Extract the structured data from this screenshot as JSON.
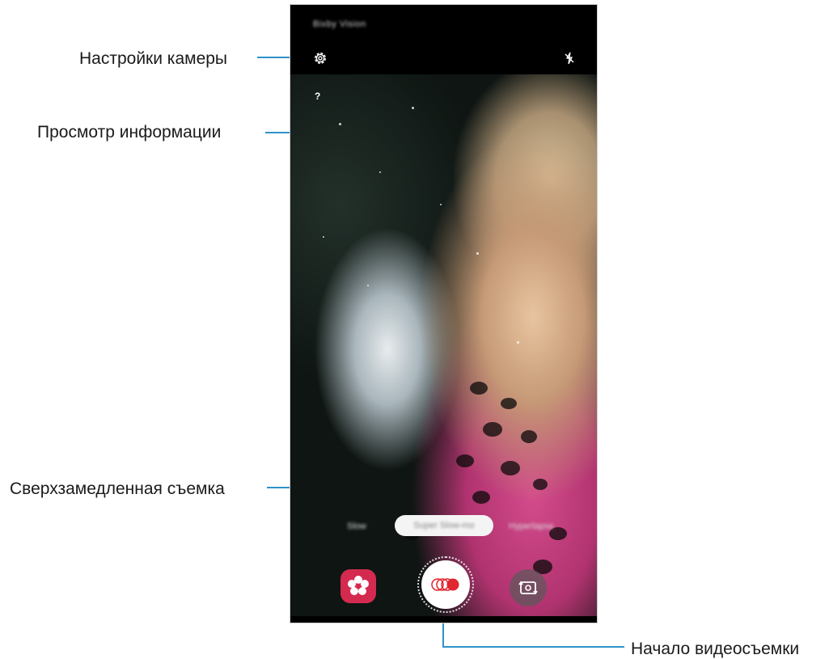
{
  "phone": {
    "mode_title": "Bixby Vision",
    "settings_icon": "gear-icon",
    "flash_icon": "flash-off-icon",
    "info_label": "?",
    "mode_pill_label": "Super Slow-mo",
    "side_modes": [
      "Slow",
      "Hyperlapse"
    ],
    "effect_button_icon": "flower-effect-icon",
    "shutter_icon": "super-slow-mo-record-icon",
    "switch_camera_icon": "switch-camera-icon"
  },
  "callouts": {
    "settings": "Настройки камеры",
    "info": "Просмотр информации",
    "super_slow": "Сверхзамедленная съемка",
    "record": "Начало видеосъемки"
  },
  "colors": {
    "callout_line": "#2f93c9",
    "effect_button": "#d42a4f",
    "record_accent": "#e0262f"
  }
}
